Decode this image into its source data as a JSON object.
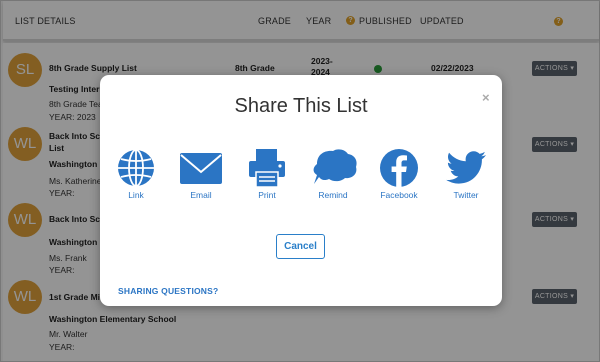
{
  "header": {
    "list_details": "LIST DETAILS",
    "grade": "GRADE",
    "year": "YEAR",
    "published": "PUBLISHED",
    "updated": "UPDATED",
    "help_glyph": "?"
  },
  "rows": [
    {
      "initials": "SL",
      "title": "8th Grade Supply List",
      "grade": "8th Grade",
      "year_line1": "2023-",
      "year_line2": "2024",
      "updated": "02/22/2023",
      "school": "Testing Intern",
      "teacher": "8th Grade Tea",
      "year_label": "YEAR: 2023",
      "actions": "ACTIONS ▾"
    },
    {
      "initials": "WL",
      "title_line1": "Back Into Scho",
      "title_line2": "List",
      "school": "Washington E",
      "teacher": "Ms. Katherine",
      "year_label": "YEAR:",
      "actions": "ACTIONS ▾"
    },
    {
      "initials": "WL",
      "title": "Back Into Scho",
      "school": "Washington E",
      "teacher": "Ms. Frank",
      "year_label": "YEAR:",
      "actions": "ACTIONS ▾"
    },
    {
      "initials": "WL",
      "title": "1st Grade Mid",
      "school": "Washington Elementary School",
      "teacher": "Mr. Walter",
      "year_label": "YEAR:",
      "actions": "ACTIONS ▾"
    }
  ],
  "modal": {
    "title": "Share This List",
    "close": "×",
    "share_options": [
      {
        "label": "Link",
        "icon": "globe-icon"
      },
      {
        "label": "Email",
        "icon": "envelope-icon"
      },
      {
        "label": "Print",
        "icon": "printer-icon"
      },
      {
        "label": "Remind",
        "icon": "speech-bubble-icon"
      },
      {
        "label": "Facebook",
        "icon": "facebook-icon"
      },
      {
        "label": "Twitter",
        "icon": "twitter-bird-icon"
      }
    ],
    "cancel": "Cancel",
    "sharing_questions": "SHARING QUESTIONS?"
  },
  "colors": {
    "accent_blue": "#2b75c4",
    "avatar_orange": "#e2a33c",
    "published_green": "#2a9c3a"
  }
}
